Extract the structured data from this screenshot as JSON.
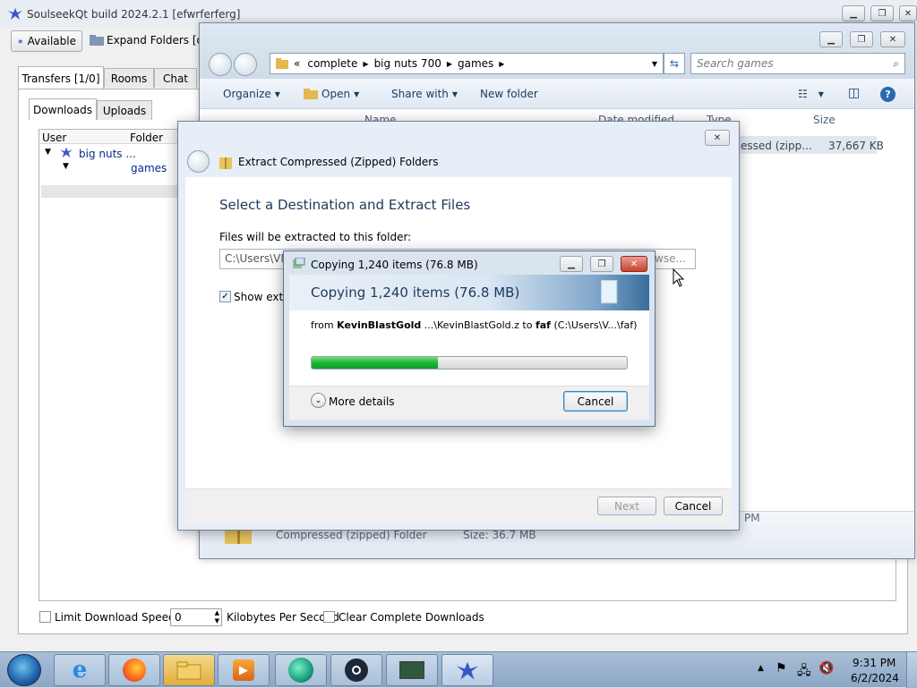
{
  "slsk": {
    "title": "SoulseekQt build 2024.2.1 [efwrferferg]",
    "status_button": "Available",
    "expand_button": "Expand Folders [on]",
    "tabs": [
      "Transfers [1/0]",
      "Rooms",
      "Chat"
    ],
    "subtabs": [
      "Downloads",
      "Uploads"
    ],
    "columns": [
      "User",
      "Folder"
    ],
    "tree_user": "big nuts ...",
    "tree_folder": "games",
    "limit_label": "Limit Download Speed to",
    "speed_value": "0",
    "speed_unit": "Kilobytes Per Second",
    "clear_label": "Clear Complete Downloads"
  },
  "explorer": {
    "breadcrumb": [
      "«",
      "complete",
      "big nuts 700",
      "games"
    ],
    "search_placeholder": "Search games",
    "commands": [
      "Organize",
      "Open",
      "Share with",
      "New folder"
    ],
    "columns": [
      "Name",
      "Date modified",
      "Type",
      "Size"
    ],
    "row_type": "essed (zipp...",
    "row_size": "37,667 KB",
    "details_type": "Compressed (zipped) Folder",
    "details_size": "Size: 36.7 MB",
    "details_time": "PM"
  },
  "wizard": {
    "title": "Extract Compressed (Zipped) Folders",
    "heading": "Select a Destination and Extract Files",
    "folder_label": "Files will be extracted to this folder:",
    "path_value": "C:\\Users\\VM",
    "browse_label": "wse...",
    "show_label": "Show extra",
    "next_label": "Next",
    "cancel_label": "Cancel"
  },
  "copy": {
    "title": "Copying 1,240 items (76.8 MB)",
    "header": "Copying 1,240 items (76.8 MB)",
    "from_word": "from",
    "source": "KevinBlastGold",
    "source_path": "...\\KevinBlastGold.z",
    "to_word": "to",
    "dest": "faf",
    "dest_path": "(C:\\Users\\V...\\faf)",
    "progress": 0.4,
    "more_details": "More details",
    "cancel_label": "Cancel"
  },
  "taskbar": {
    "time": "9:31 PM",
    "date": "6/2/2024",
    "apps": [
      "internet-explorer",
      "firefox",
      "file-explorer",
      "media-player",
      "app-green",
      "steam",
      "monitor",
      "soulseek"
    ]
  },
  "colors": {
    "accent": "#1e395b",
    "link": "#0b2a8a",
    "progress_green": "#1db634"
  }
}
